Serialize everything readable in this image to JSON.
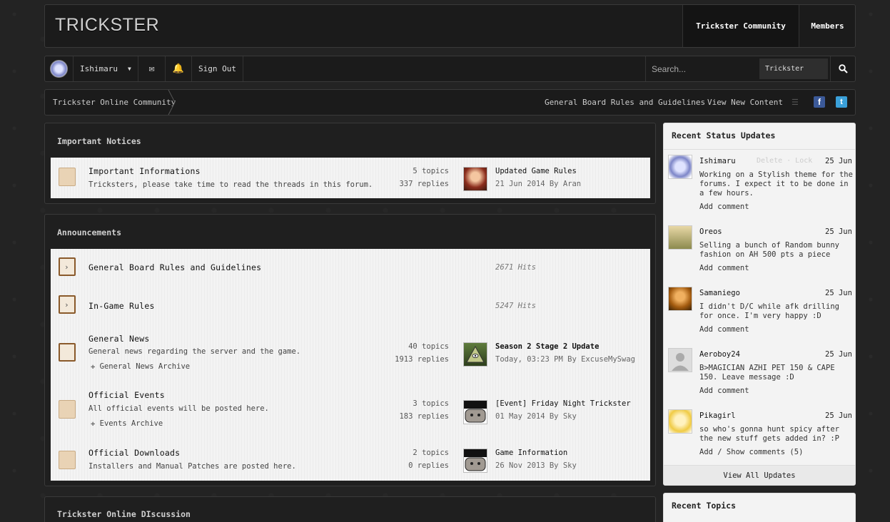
{
  "header": {
    "logo": "TRICKSTER",
    "tab_community": "Trickster Community",
    "tab_members": "Members"
  },
  "nav": {
    "username": "Ishimaru",
    "signout": "Sign Out",
    "search_placeholder": "Search...",
    "search_scope": "Trickster"
  },
  "crumb": {
    "home": "Trickster Online Community",
    "link_rules": "General Board Rules and Guidelines",
    "link_new": "View New Content"
  },
  "notices": {
    "title": "Important Notices",
    "forum": {
      "name": "Important Informations",
      "desc": "Tricksters, please take time to read the threads in this forum.",
      "topics": "5 topics",
      "replies": "337 replies",
      "last_title": "Updated Game Rules",
      "last_meta": "21 Jun 2014 By Aran"
    }
  },
  "announcements": {
    "title": "Announcements",
    "forums": [
      {
        "name": "General Board Rules and Guidelines",
        "hits": "2671 Hits"
      },
      {
        "name": "In-Game Rules",
        "hits": "5247 Hits"
      },
      {
        "name": "General News",
        "desc": "General news regarding the server and the game.",
        "sub": "General News Archive",
        "topics": "40 topics",
        "replies": "1913 replies",
        "last_title": "Season 2 Stage 2 Update",
        "last_meta": "Today, 03:23 PM By ExcuseMySwag"
      },
      {
        "name": "Official Events",
        "desc": "All official events will be posted here.",
        "sub": "Events Archive",
        "topics": "3 topics",
        "replies": "183 replies",
        "last_title": "[Event] Friday Night Trickster",
        "last_meta": "01 May 2014 By Sky"
      },
      {
        "name": "Official Downloads",
        "desc": "Installers and Manual Patches are posted here.",
        "topics": "2 topics",
        "replies": "0 replies",
        "last_title": "Game Information",
        "last_meta": "26 Nov 2013 By Sky"
      }
    ]
  },
  "discussion": {
    "title": "Trickster Online DIscussion"
  },
  "status": {
    "title": "Recent Status Updates",
    "items": [
      {
        "user": "Ishimaru",
        "actions": "Delete · Lock",
        "date": "25 Jun",
        "text": "Working on a Stylish theme for the forums. I expect it to be done in a few hours.",
        "add": "Add comment"
      },
      {
        "user": "Oreos",
        "date": "25 Jun",
        "text": "Selling a bunch of Random bunny fashion on AH 500 pts a piece",
        "add": "Add comment"
      },
      {
        "user": "Samaniego",
        "date": "25 Jun",
        "text": "I didn't D/C while afk drilling for once. I'm very happy :D",
        "add": "Add comment"
      },
      {
        "user": "Aeroboy24",
        "date": "25 Jun",
        "text": "B>MAGICIAN AZHI PET 150 & CAPE 150. Leave message :D",
        "add": "Add comment"
      },
      {
        "user": "Pikagirl",
        "date": "25 Jun",
        "text": "so who's gonna hunt spicy after the new stuff gets added in? :P",
        "add": "Add / Show comments (5)"
      }
    ],
    "view_all": "View All Updates"
  },
  "topics": {
    "title": "Recent Topics"
  },
  "colors": {
    "accent_dark": "#1b1b1b",
    "list_bg": "#f1f1f1",
    "facebook": "#3b5998",
    "twitter": "#3aa0d9"
  }
}
